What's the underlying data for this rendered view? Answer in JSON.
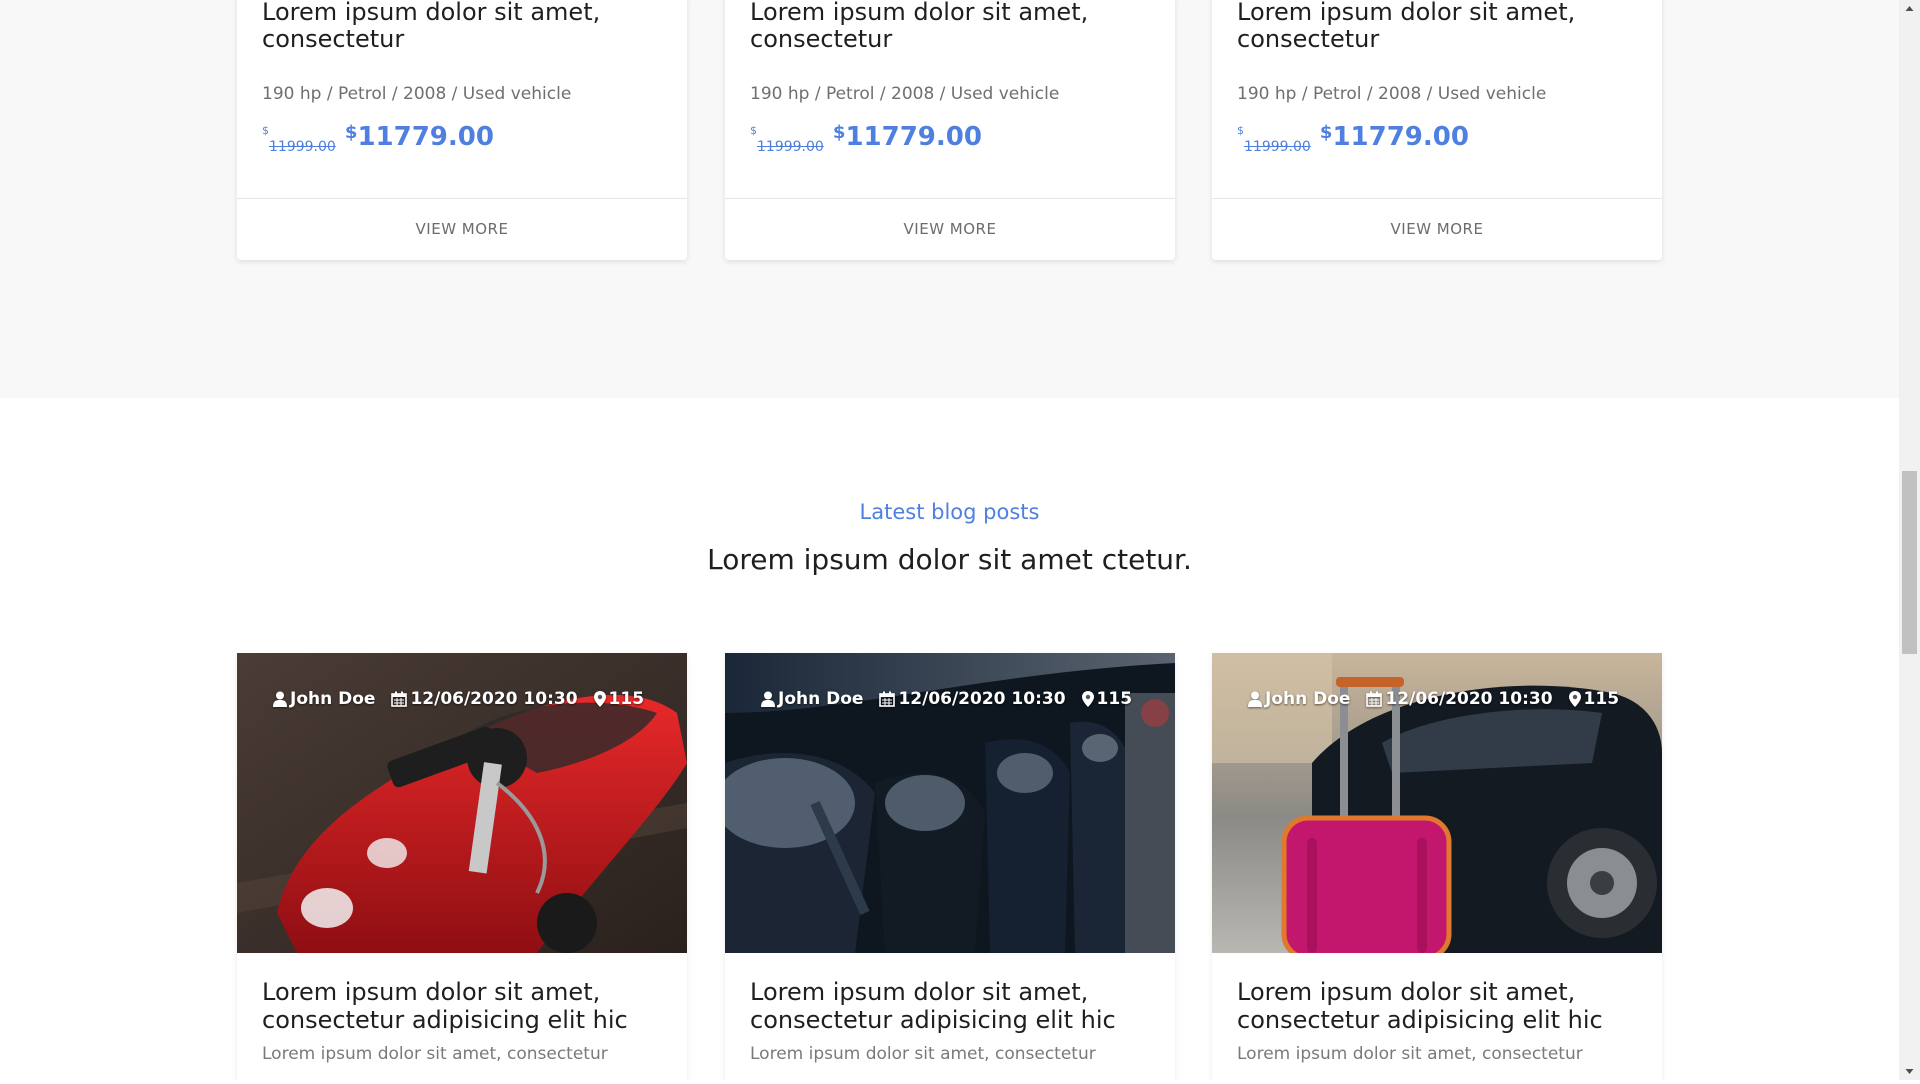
{
  "vehicles": {
    "cards": [
      {
        "title": "Lorem ipsum dolor sit amet, consectetur",
        "specs": "190 hp / Petrol / 2008 / Used vehicle",
        "currency": "$",
        "old_price": "11999.00",
        "new_price": "11779.00",
        "cta": "VIEW MORE"
      },
      {
        "title": "Lorem ipsum dolor sit amet, consectetur",
        "specs": "190 hp / Petrol / 2008 / Used vehicle",
        "currency": "$",
        "old_price": "11999.00",
        "new_price": "11779.00",
        "cta": "VIEW MORE"
      },
      {
        "title": "Lorem ipsum dolor sit amet, consectetur",
        "specs": "190 hp / Petrol / 2008 / Used vehicle",
        "currency": "$",
        "old_price": "11999.00",
        "new_price": "11779.00",
        "cta": "VIEW MORE"
      }
    ]
  },
  "blog": {
    "eyebrow": "Latest blog posts",
    "heading": "Lorem ipsum dolor sit amet ctetur.",
    "posts": [
      {
        "author": "John Doe",
        "date": "12/06/2020 10:30",
        "views": "115",
        "title": "Lorem ipsum dolor sit amet, consectetur adipisicing elit hic",
        "excerpt": "Lorem ipsum dolor sit amet, consectetur",
        "image": "red toy convertible car with keys"
      },
      {
        "author": "John Doe",
        "date": "12/06/2020 10:30",
        "views": "115",
        "title": "Lorem ipsum dolor sit amet, consectetur adipisicing elit hic",
        "excerpt": "Lorem ipsum dolor sit amet, consectetur",
        "image": "row of parked black cars headlights"
      },
      {
        "author": "John Doe",
        "date": "12/06/2020 10:30",
        "views": "115",
        "title": "Lorem ipsum dolor sit amet, consectetur adipisicing elit hic",
        "excerpt": "Lorem ipsum dolor sit amet, consectetur",
        "image": "pink suitcase beside black car"
      }
    ]
  },
  "icons": {
    "author": "user-icon",
    "date": "calendar-icon",
    "views": "map-marker-icon"
  },
  "colors": {
    "accent": "#4f80e1",
    "section_gray": "#f8f8f8",
    "text_dark": "#1f1f1f",
    "text_muted": "#6f6f6f"
  }
}
